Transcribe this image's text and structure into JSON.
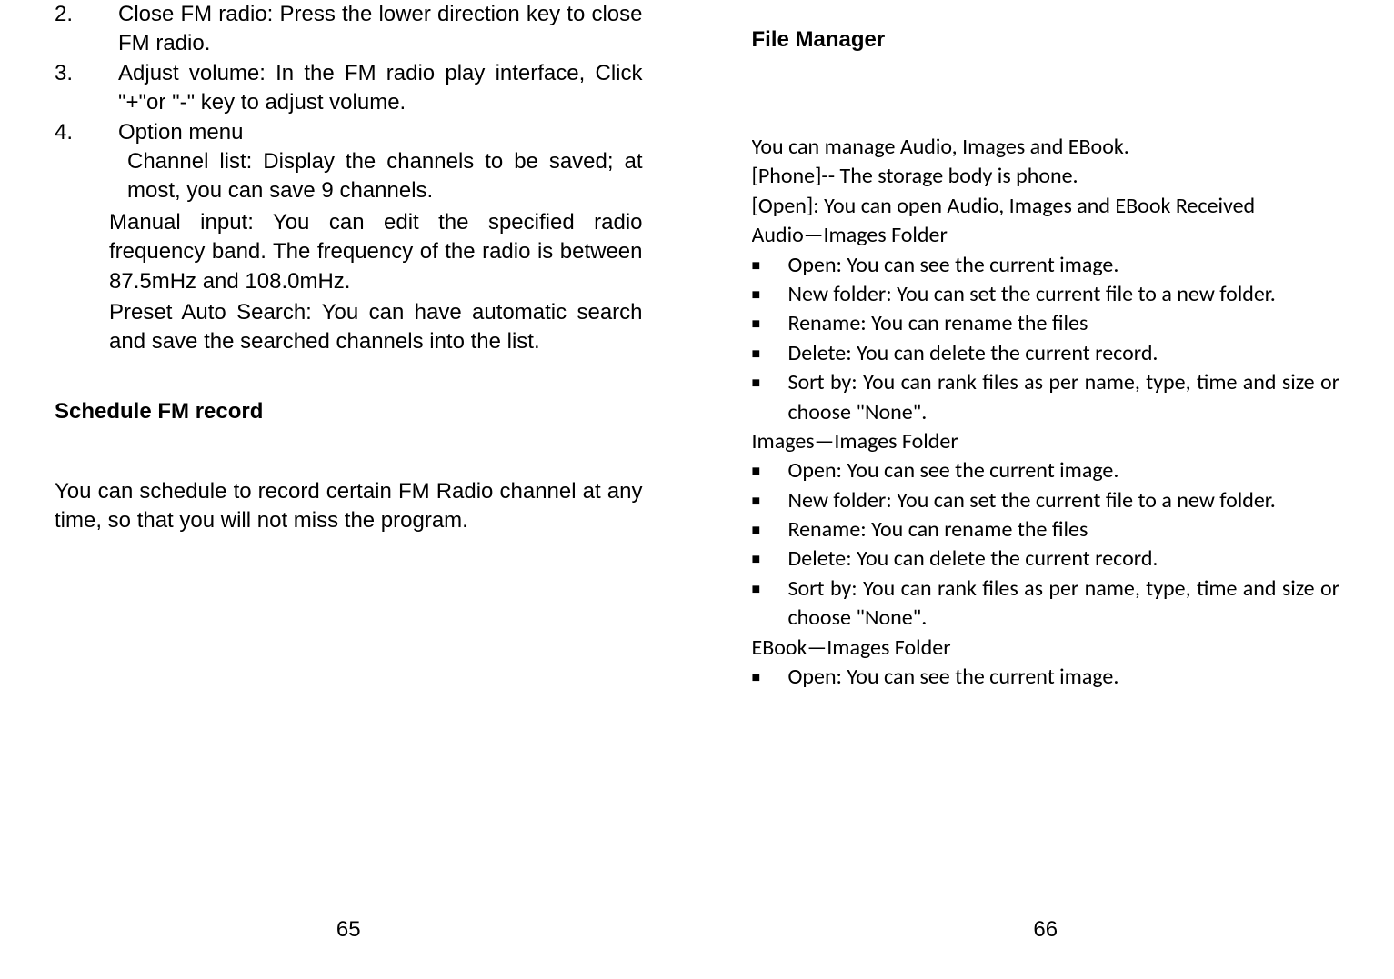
{
  "left": {
    "pageNumber": "65",
    "items": [
      {
        "num": "2.",
        "text": "Close FM radio: Press the lower direction key to close FM radio."
      },
      {
        "num": "3.",
        "text": "Adjust volume: In the FM radio play interface, Click \"+\"or \"-\" key to adjust volume."
      },
      {
        "num": "4.",
        "text": "Option menu"
      }
    ],
    "optionSub1": "Channel list: Display the channels to be saved; at most, you can save 9 channels.",
    "optionSub2": "Manual input: You can edit the specified radio frequency band. The frequency of the radio is between 87.5mHz and 108.0mHz.",
    "optionSub3": "Preset Auto Search: You can have automatic search and save the searched channels into the list.",
    "scheduleHeading": "Schedule FM record",
    "scheduleBody": "You can schedule to record certain FM Radio channel at any time, so that you will not miss the program."
  },
  "right": {
    "pageNumber": "66",
    "heading": "File Manager",
    "intro1": "You can manage Audio, Images and EBook.",
    "intro2": "[Phone]-- The storage body is phone.",
    "intro3": "[Open]: You can open Audio, Images and EBook Received",
    "sec1Title": "Audio—Images Folder",
    "sec1": [
      "Open: You can see the current image.",
      "New folder: You can set the current file to a new folder.",
      "Rename: You can rename the files",
      "Delete: You can delete the current record.",
      "Sort by: You can rank files as per name, type, time and size or choose \"None\"."
    ],
    "sec2Title": "Images—Images Folder",
    "sec2": [
      "Open: You can see the current image.",
      "New folder: You can set the current file to a new folder.",
      "Rename: You can rename the files",
      "Delete: You can delete the current record.",
      "Sort by: You can rank files as per name, type, time and size or choose \"None\"."
    ],
    "sec3Title": "EBook—Images Folder",
    "sec3": [
      "Open: You can see the current image."
    ]
  }
}
